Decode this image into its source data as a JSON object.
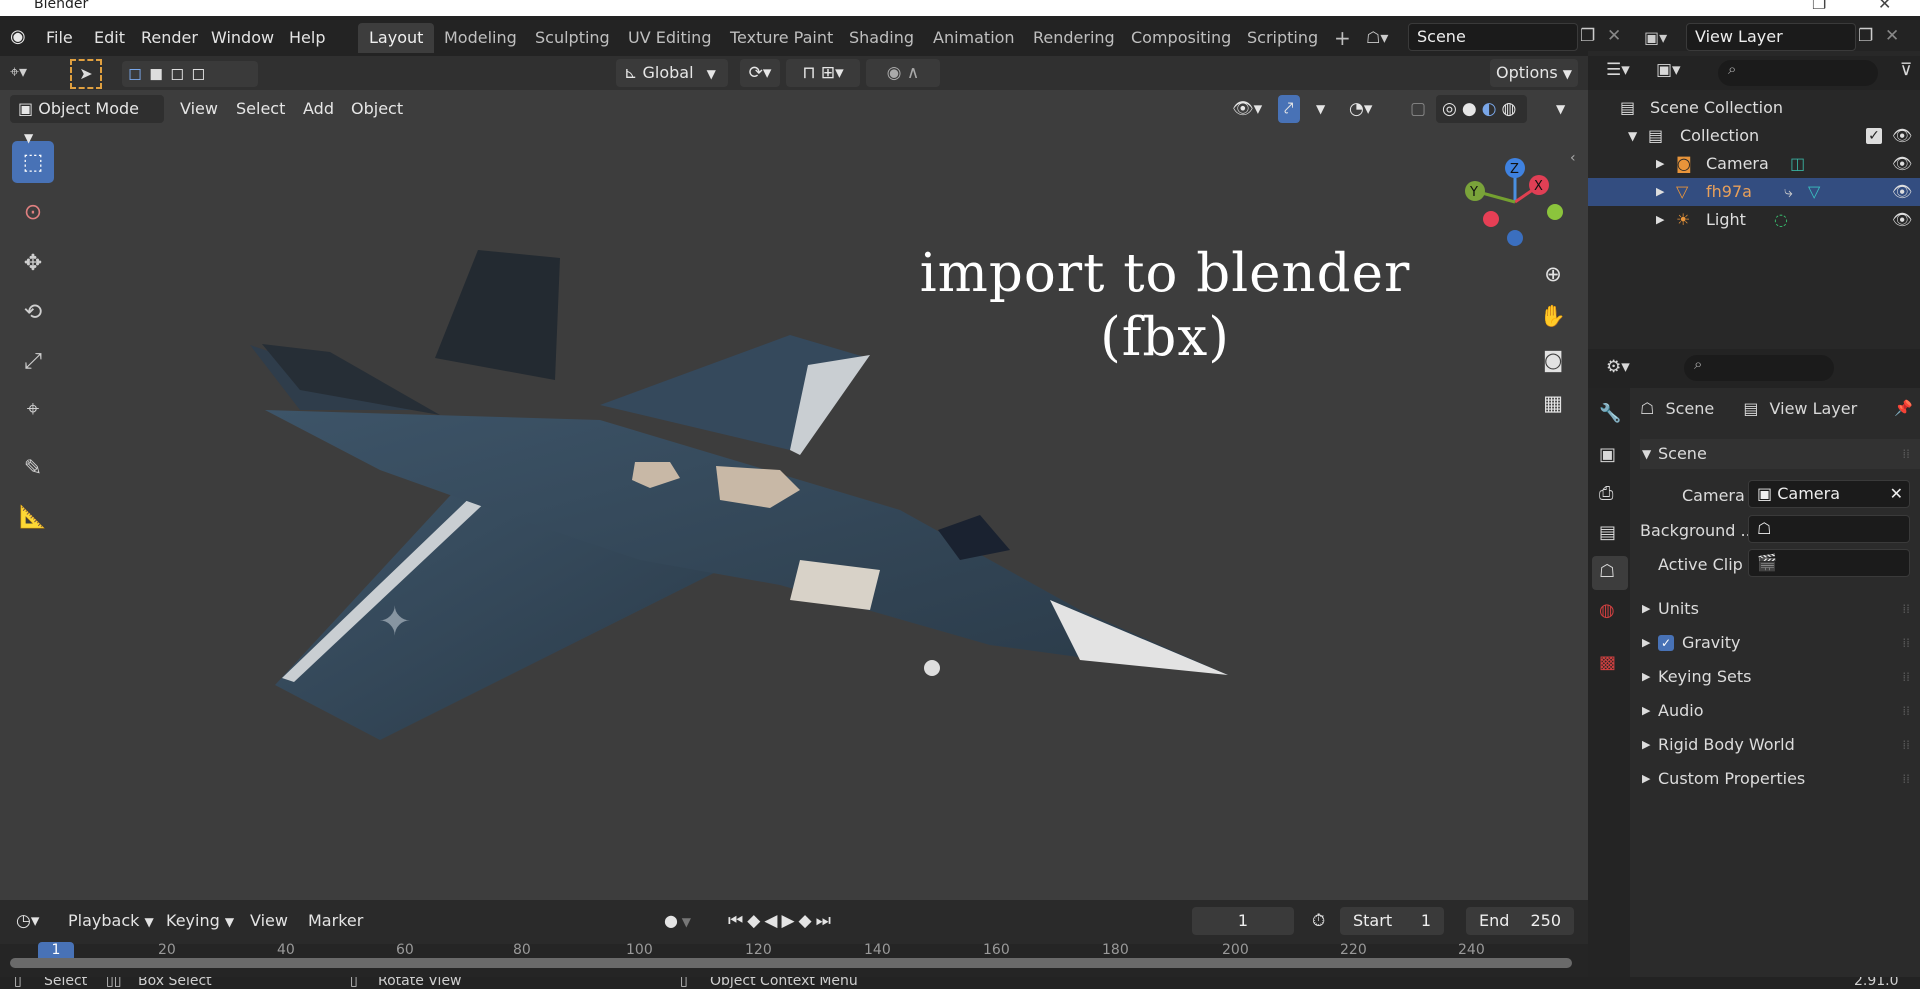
{
  "app": {
    "title": "Blender",
    "version": "2.91.0"
  },
  "menu": [
    "File",
    "Edit",
    "Render",
    "Window",
    "Help"
  ],
  "workspaces": [
    "Layout",
    "Modeling",
    "Sculpting",
    "UV Editing",
    "Texture Paint",
    "Shading",
    "Animation",
    "Rendering",
    "Compositing",
    "Scripting"
  ],
  "active_workspace": "Layout",
  "scene_field": "Scene",
  "view_layer_field": "View Layer",
  "toolbar": {
    "orientation": "Global",
    "options": "Options"
  },
  "viewport_header": {
    "mode": "Object Mode",
    "items": [
      "View",
      "Select",
      "Add",
      "Object"
    ]
  },
  "gizmo": {
    "x": "X",
    "y": "Y",
    "z": "Z"
  },
  "overlay_text": {
    "line1": "import to blender",
    "line2": "(fbx)"
  },
  "timeline": {
    "items": [
      "Playback",
      "Keying",
      "View",
      "Marker"
    ],
    "current_frame": "1",
    "start_label": "Start",
    "start": "1",
    "end_label": "End",
    "end": "250",
    "ruler": [
      "1",
      "20",
      "40",
      "60",
      "80",
      "100",
      "120",
      "140",
      "160",
      "180",
      "200",
      "220",
      "240"
    ]
  },
  "statusbar": {
    "select": "Select",
    "box_select": "Box Select",
    "rotate_view": "Rotate View",
    "context_menu": "Object Context Menu"
  },
  "outliner": {
    "root": "Scene Collection",
    "collection": "Collection",
    "items": [
      {
        "name": "Camera",
        "color": "#dcdcdc"
      },
      {
        "name": "fh97a",
        "color": "#e8a05a"
      },
      {
        "name": "Light",
        "color": "#dcdcdc"
      }
    ]
  },
  "properties": {
    "tab_scene": "Scene",
    "tab_view_layer": "View Layer",
    "panel_title": "Scene",
    "camera_label": "Camera",
    "camera_value": "Camera",
    "background_label": "Background ...",
    "active_clip_label": "Active Clip",
    "sections": [
      "Units",
      "Gravity",
      "Keying Sets",
      "Audio",
      "Rigid Body World",
      "Custom Properties"
    ],
    "gravity_checked": true
  },
  "colors": {
    "accent": "#4872b6",
    "selected_row": "#334d80",
    "viewport_bg": "#3d3d3d"
  }
}
